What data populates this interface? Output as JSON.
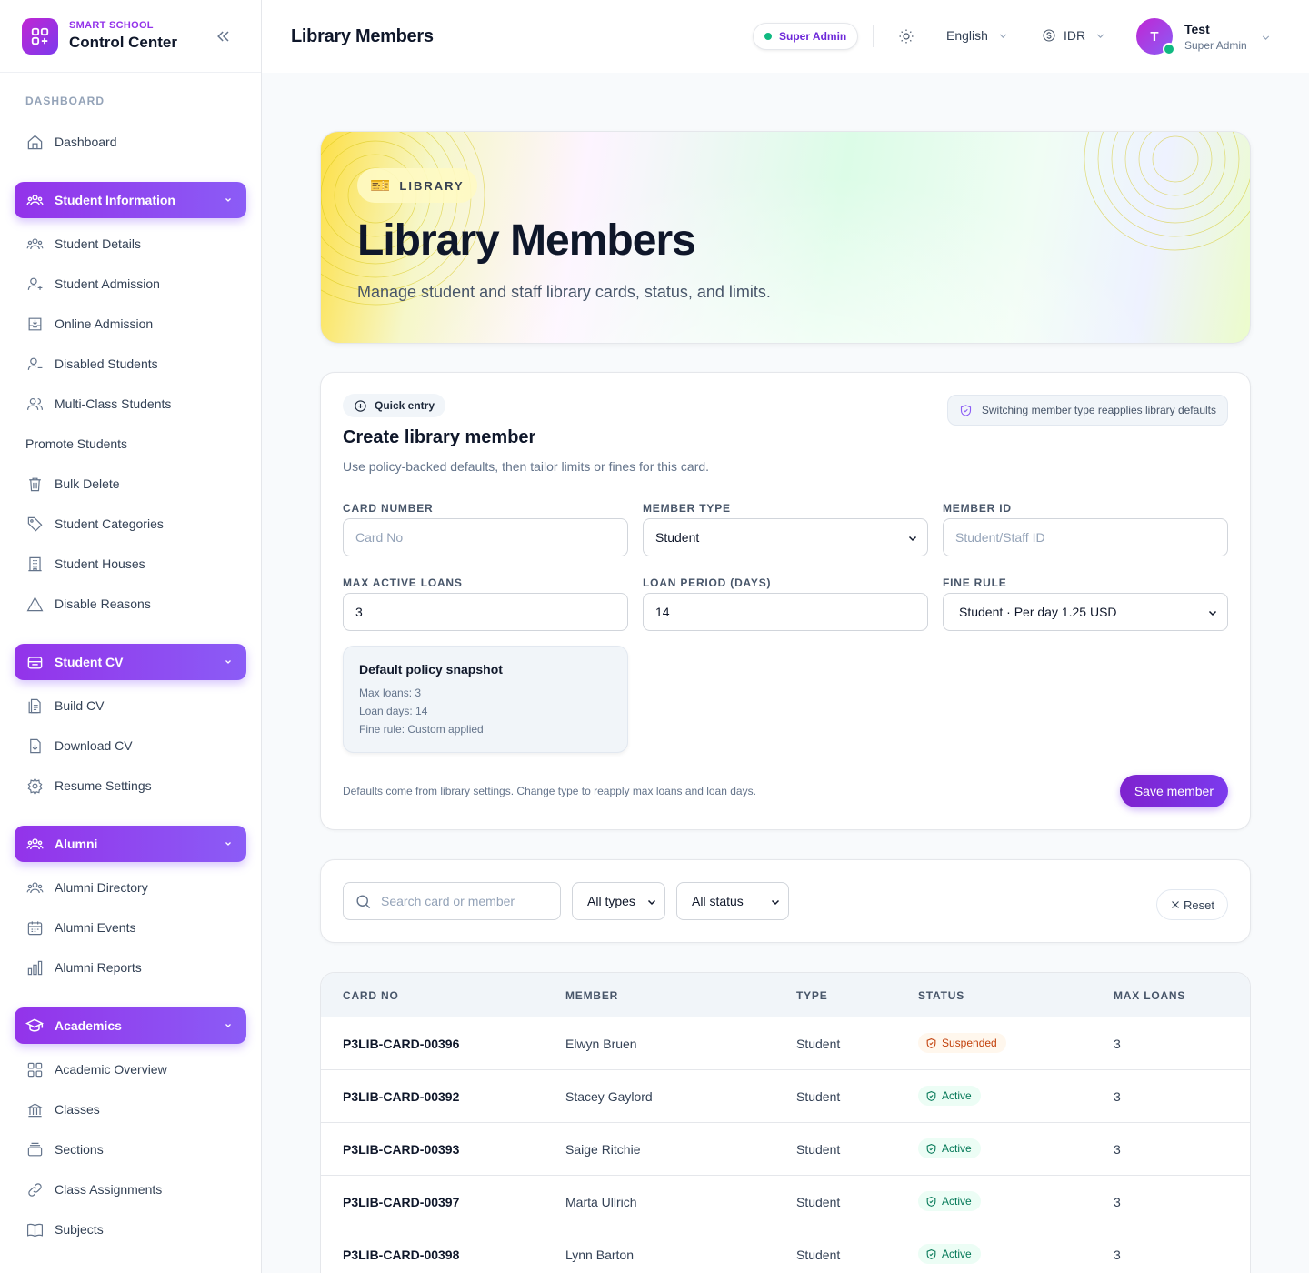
{
  "brand": {
    "subtitle": "SMART SCHOOL",
    "title": "Control Center"
  },
  "sidebar": {
    "section_dashboard": "DASHBOARD",
    "dashboard": "Dashboard",
    "student_information": {
      "label": "Student Information",
      "items": [
        "Student Details",
        "Student Admission",
        "Online Admission",
        "Disabled Students",
        "Multi-Class Students",
        "Promote Students",
        "Bulk Delete",
        "Student Categories",
        "Student Houses",
        "Disable Reasons"
      ]
    },
    "student_cv": {
      "label": "Student CV",
      "items": [
        "Build CV",
        "Download CV",
        "Resume Settings"
      ]
    },
    "alumni": {
      "label": "Alumni",
      "items": [
        "Alumni Directory",
        "Alumni Events",
        "Alumni Reports"
      ]
    },
    "academics": {
      "label": "Academics",
      "items": [
        "Academic Overview",
        "Classes",
        "Sections",
        "Class Assignments",
        "Subjects"
      ]
    }
  },
  "header": {
    "title": "Library Members",
    "role": "Super Admin",
    "language": "English",
    "currency": "IDR",
    "user": {
      "initial": "T",
      "name": "Test",
      "role": "Super Admin"
    }
  },
  "hero": {
    "badge": "LIBRARY",
    "title": "Library Members",
    "subtitle": "Manage student and staff library cards, status, and limits."
  },
  "form": {
    "badge": "Quick entry",
    "note": "Switching member type reapplies library defaults",
    "title": "Create library member",
    "subtitle": "Use policy-backed defaults, then tailor limits or fines for this card.",
    "card_number": {
      "label": "CARD NUMBER",
      "placeholder": "Card No"
    },
    "member_type": {
      "label": "MEMBER TYPE",
      "value": "Student"
    },
    "member_id": {
      "label": "MEMBER ID",
      "placeholder": "Student/Staff ID"
    },
    "max_active_loans": {
      "label": "MAX ACTIVE LOANS",
      "value": "3"
    },
    "loan_period": {
      "label": "LOAN PERIOD (DAYS)",
      "value": "14"
    },
    "fine_rule": {
      "label": "FINE RULE",
      "value": "Student · Per day 1.25 USD"
    },
    "snapshot": {
      "title": "Default policy snapshot",
      "max_loans": "Max loans: 3",
      "loan_days": "Loan days: 14",
      "fine_rule": "Fine rule: Custom applied"
    },
    "footer_note": "Defaults come from library settings. Change type to reapply max loans and loan days.",
    "save_label": "Save member"
  },
  "filters": {
    "search_placeholder": "Search card or member",
    "type_value": "All types",
    "status_value": "All status",
    "reset_label": "Reset"
  },
  "table": {
    "columns": [
      "CARD NO",
      "MEMBER",
      "TYPE",
      "STATUS",
      "MAX LOANS"
    ],
    "rows": [
      {
        "card_no": "P3LIB-CARD-00396",
        "member": "Elwyn Bruen",
        "type": "Student",
        "status": "Suspended",
        "max_loans": "3"
      },
      {
        "card_no": "P3LIB-CARD-00392",
        "member": "Stacey Gaylord",
        "type": "Student",
        "status": "Active",
        "max_loans": "3"
      },
      {
        "card_no": "P3LIB-CARD-00393",
        "member": "Saige Ritchie",
        "type": "Student",
        "status": "Active",
        "max_loans": "3"
      },
      {
        "card_no": "P3LIB-CARD-00397",
        "member": "Marta Ullrich",
        "type": "Student",
        "status": "Active",
        "max_loans": "3"
      },
      {
        "card_no": "P3LIB-CARD-00398",
        "member": "Lynn Barton",
        "type": "Student",
        "status": "Active",
        "max_loans": "3"
      }
    ]
  },
  "colors": {
    "accent": "#7c3aed",
    "active": "#047857",
    "suspended": "#c2410c",
    "online": "#10b981"
  }
}
